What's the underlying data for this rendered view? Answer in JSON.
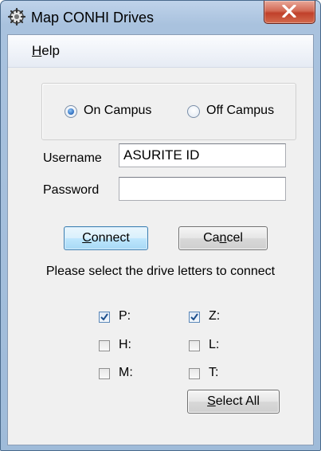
{
  "window": {
    "title": "Map CONHI Drives",
    "icon": "network-drive-icon"
  },
  "menu": {
    "help_prefix": "",
    "help_mnemonic": "H",
    "help_rest": "elp"
  },
  "location": {
    "on_campus_label": "On Campus",
    "off_campus_label": "Off Campus",
    "selected": "On Campus"
  },
  "credentials": {
    "username_label": "Username",
    "username_value": "ASURITE ID",
    "password_label": "Password",
    "password_value": ""
  },
  "buttons": {
    "connect_mnemonic": "C",
    "connect_rest": "onnect",
    "cancel_pre": "Ca",
    "cancel_mnemonic": "n",
    "cancel_rest": "cel",
    "select_all_mnemonic": "S",
    "select_all_rest": "elect All"
  },
  "drives": {
    "prompt": "Please select the drive letters to connect",
    "items": [
      {
        "letter": "P:",
        "checked": true
      },
      {
        "letter": "Z:",
        "checked": true
      },
      {
        "letter": "H:",
        "checked": false
      },
      {
        "letter": "L:",
        "checked": false
      },
      {
        "letter": "M:",
        "checked": false
      },
      {
        "letter": "T:",
        "checked": false
      }
    ]
  },
  "colors": {
    "title_bar": "#a9c2de",
    "close_button": "#c0402a",
    "default_button_border": "#3c7fb1"
  }
}
